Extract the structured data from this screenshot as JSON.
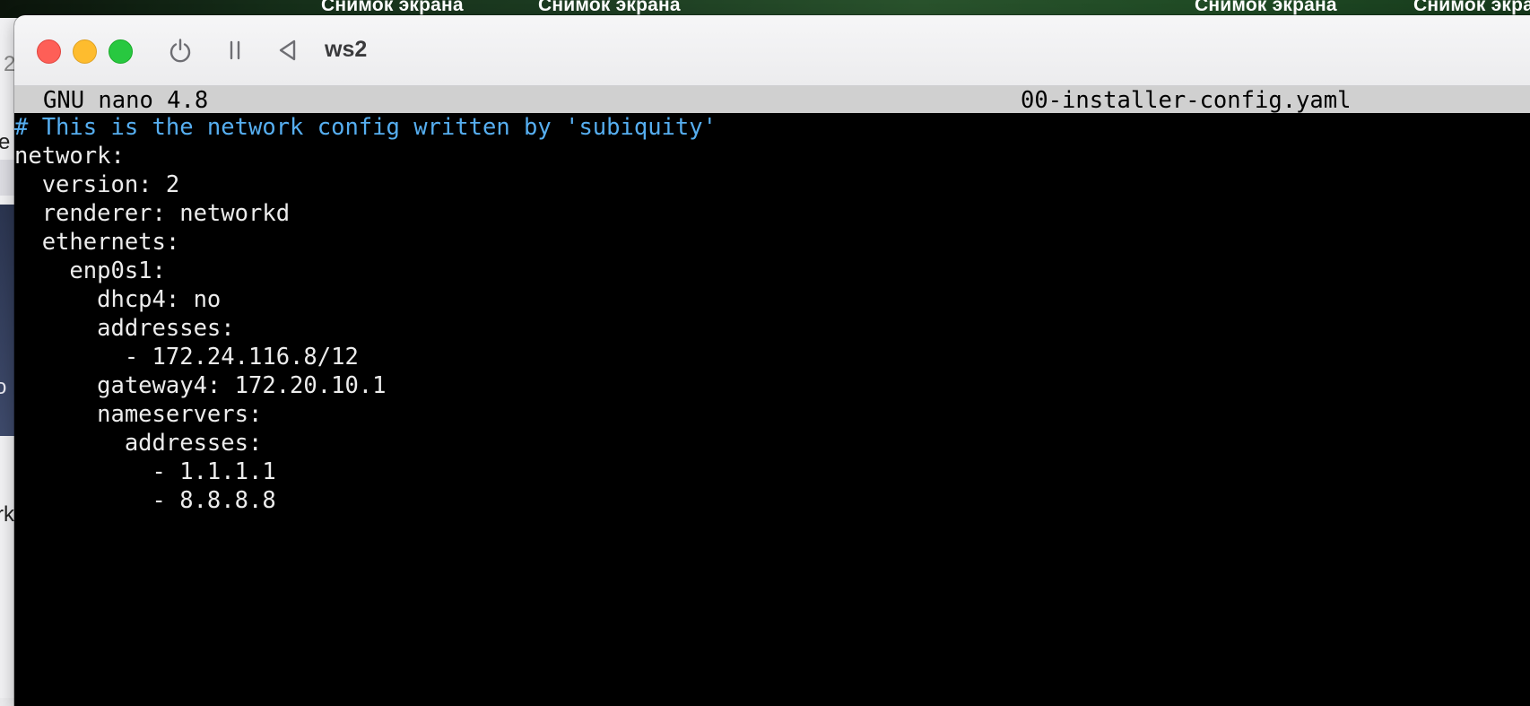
{
  "desktop": {
    "labels": [
      "Снимок экрана",
      "Снимок экрана",
      "Снимок экрана",
      "Снимок экрана"
    ]
  },
  "background_app": {
    "fragments": [
      "2",
      "e",
      "o",
      "rk"
    ]
  },
  "window": {
    "title": "ws2",
    "controls": {
      "close": "close-icon",
      "minimize": "minimize-icon",
      "maximize": "maximize-icon",
      "power": "power-icon",
      "pause": "pause-icon",
      "back": "back-icon"
    }
  },
  "nano": {
    "version": "GNU nano 4.8",
    "filename": "00-installer-config.yaml"
  },
  "buffer": {
    "lines": [
      {
        "text": "# This is the network config written by 'subiquity'",
        "type": "comment"
      },
      {
        "text": "network:",
        "type": "code"
      },
      {
        "text": "  version: 2",
        "type": "code"
      },
      {
        "text": "  renderer: networkd",
        "type": "code"
      },
      {
        "text": "  ethernets:",
        "type": "code"
      },
      {
        "text": "    enp0s1:",
        "type": "code"
      },
      {
        "text": "      dhcp4: no",
        "type": "code"
      },
      {
        "text": "      addresses:",
        "type": "code"
      },
      {
        "text": "        - 172.24.116.8/12",
        "type": "code"
      },
      {
        "text": "      gateway4: 172.20.10.1",
        "type": "code"
      },
      {
        "text": "      nameservers:",
        "type": "code"
      },
      {
        "text": "        addresses:",
        "type": "code"
      },
      {
        "text": "          - 1.1.1.1",
        "type": "code"
      },
      {
        "text": "          - 8.8.8.8",
        "type": "code"
      }
    ]
  },
  "colors": {
    "comment": "#56aef0",
    "text": "#ececec",
    "terminal_bg": "#000000",
    "nano_header_bg": "#d0d0d0"
  }
}
